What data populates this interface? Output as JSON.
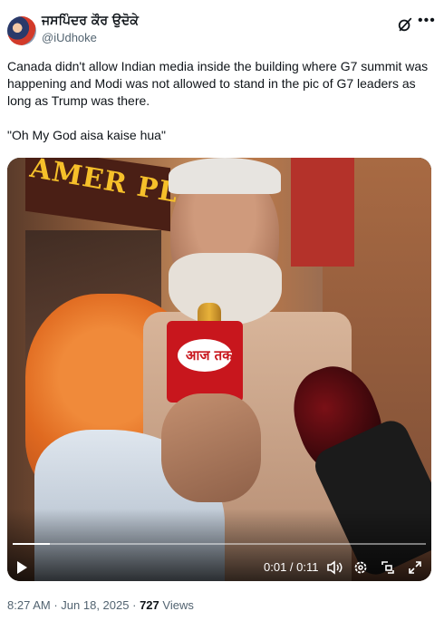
{
  "author": {
    "display_name": "ਜਸਪਿੰਦਰ ਕੌਰ ਉਦੋਕੇ",
    "handle": "@iUdhoke"
  },
  "tweet": {
    "text": "Canada didn't allow Indian media inside the building where G7 summit was happening and Modi was not allowed to stand in the pic of G7 leaders as long as Trump was there.\n\n\"Oh My God aisa kaise hua\""
  },
  "video": {
    "sign_text": "AMER PLAT",
    "mic_logo": "आज तक",
    "time_display": "0:01 / 0:11",
    "progress_fraction": 0.09
  },
  "meta": {
    "time": "8:27 AM",
    "separator": "·",
    "date": "Jun 18, 2025",
    "views_count": "727",
    "views_label": "Views"
  },
  "icons": {
    "grok": "grok-icon",
    "more": "more-icon",
    "play": "play-icon",
    "volume": "volume-icon",
    "settings": "settings-icon",
    "pip": "picture-in-picture-icon",
    "fullscreen": "fullscreen-icon"
  }
}
